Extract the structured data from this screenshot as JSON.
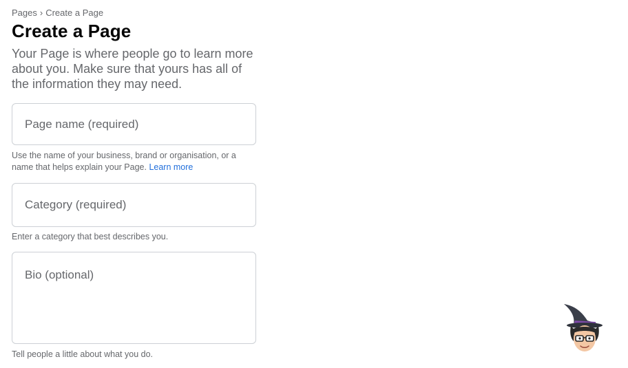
{
  "breadcrumb": {
    "root": "Pages",
    "separator": "›",
    "current": "Create a Page"
  },
  "header": {
    "title": "Create a Page",
    "description": "Your Page is where people go to learn more about you. Make sure that yours has all of the information they may need."
  },
  "form": {
    "page_name": {
      "placeholder": "Page name (required)",
      "value": "",
      "help": "Use the name of your business, brand or organisation, or a name that helps explain your Page.",
      "help_link": "Learn more"
    },
    "category": {
      "placeholder": "Category (required)",
      "value": "",
      "help": "Enter a category that best describes you."
    },
    "bio": {
      "placeholder": "Bio (optional)",
      "value": "",
      "help": "Tell people a little about what you do."
    }
  },
  "colors": {
    "link": "#216fdb",
    "secondary_text": "#65676b",
    "border": "#ccd0d5"
  },
  "icons": {
    "mascot": "wizard-avatar-icon"
  }
}
